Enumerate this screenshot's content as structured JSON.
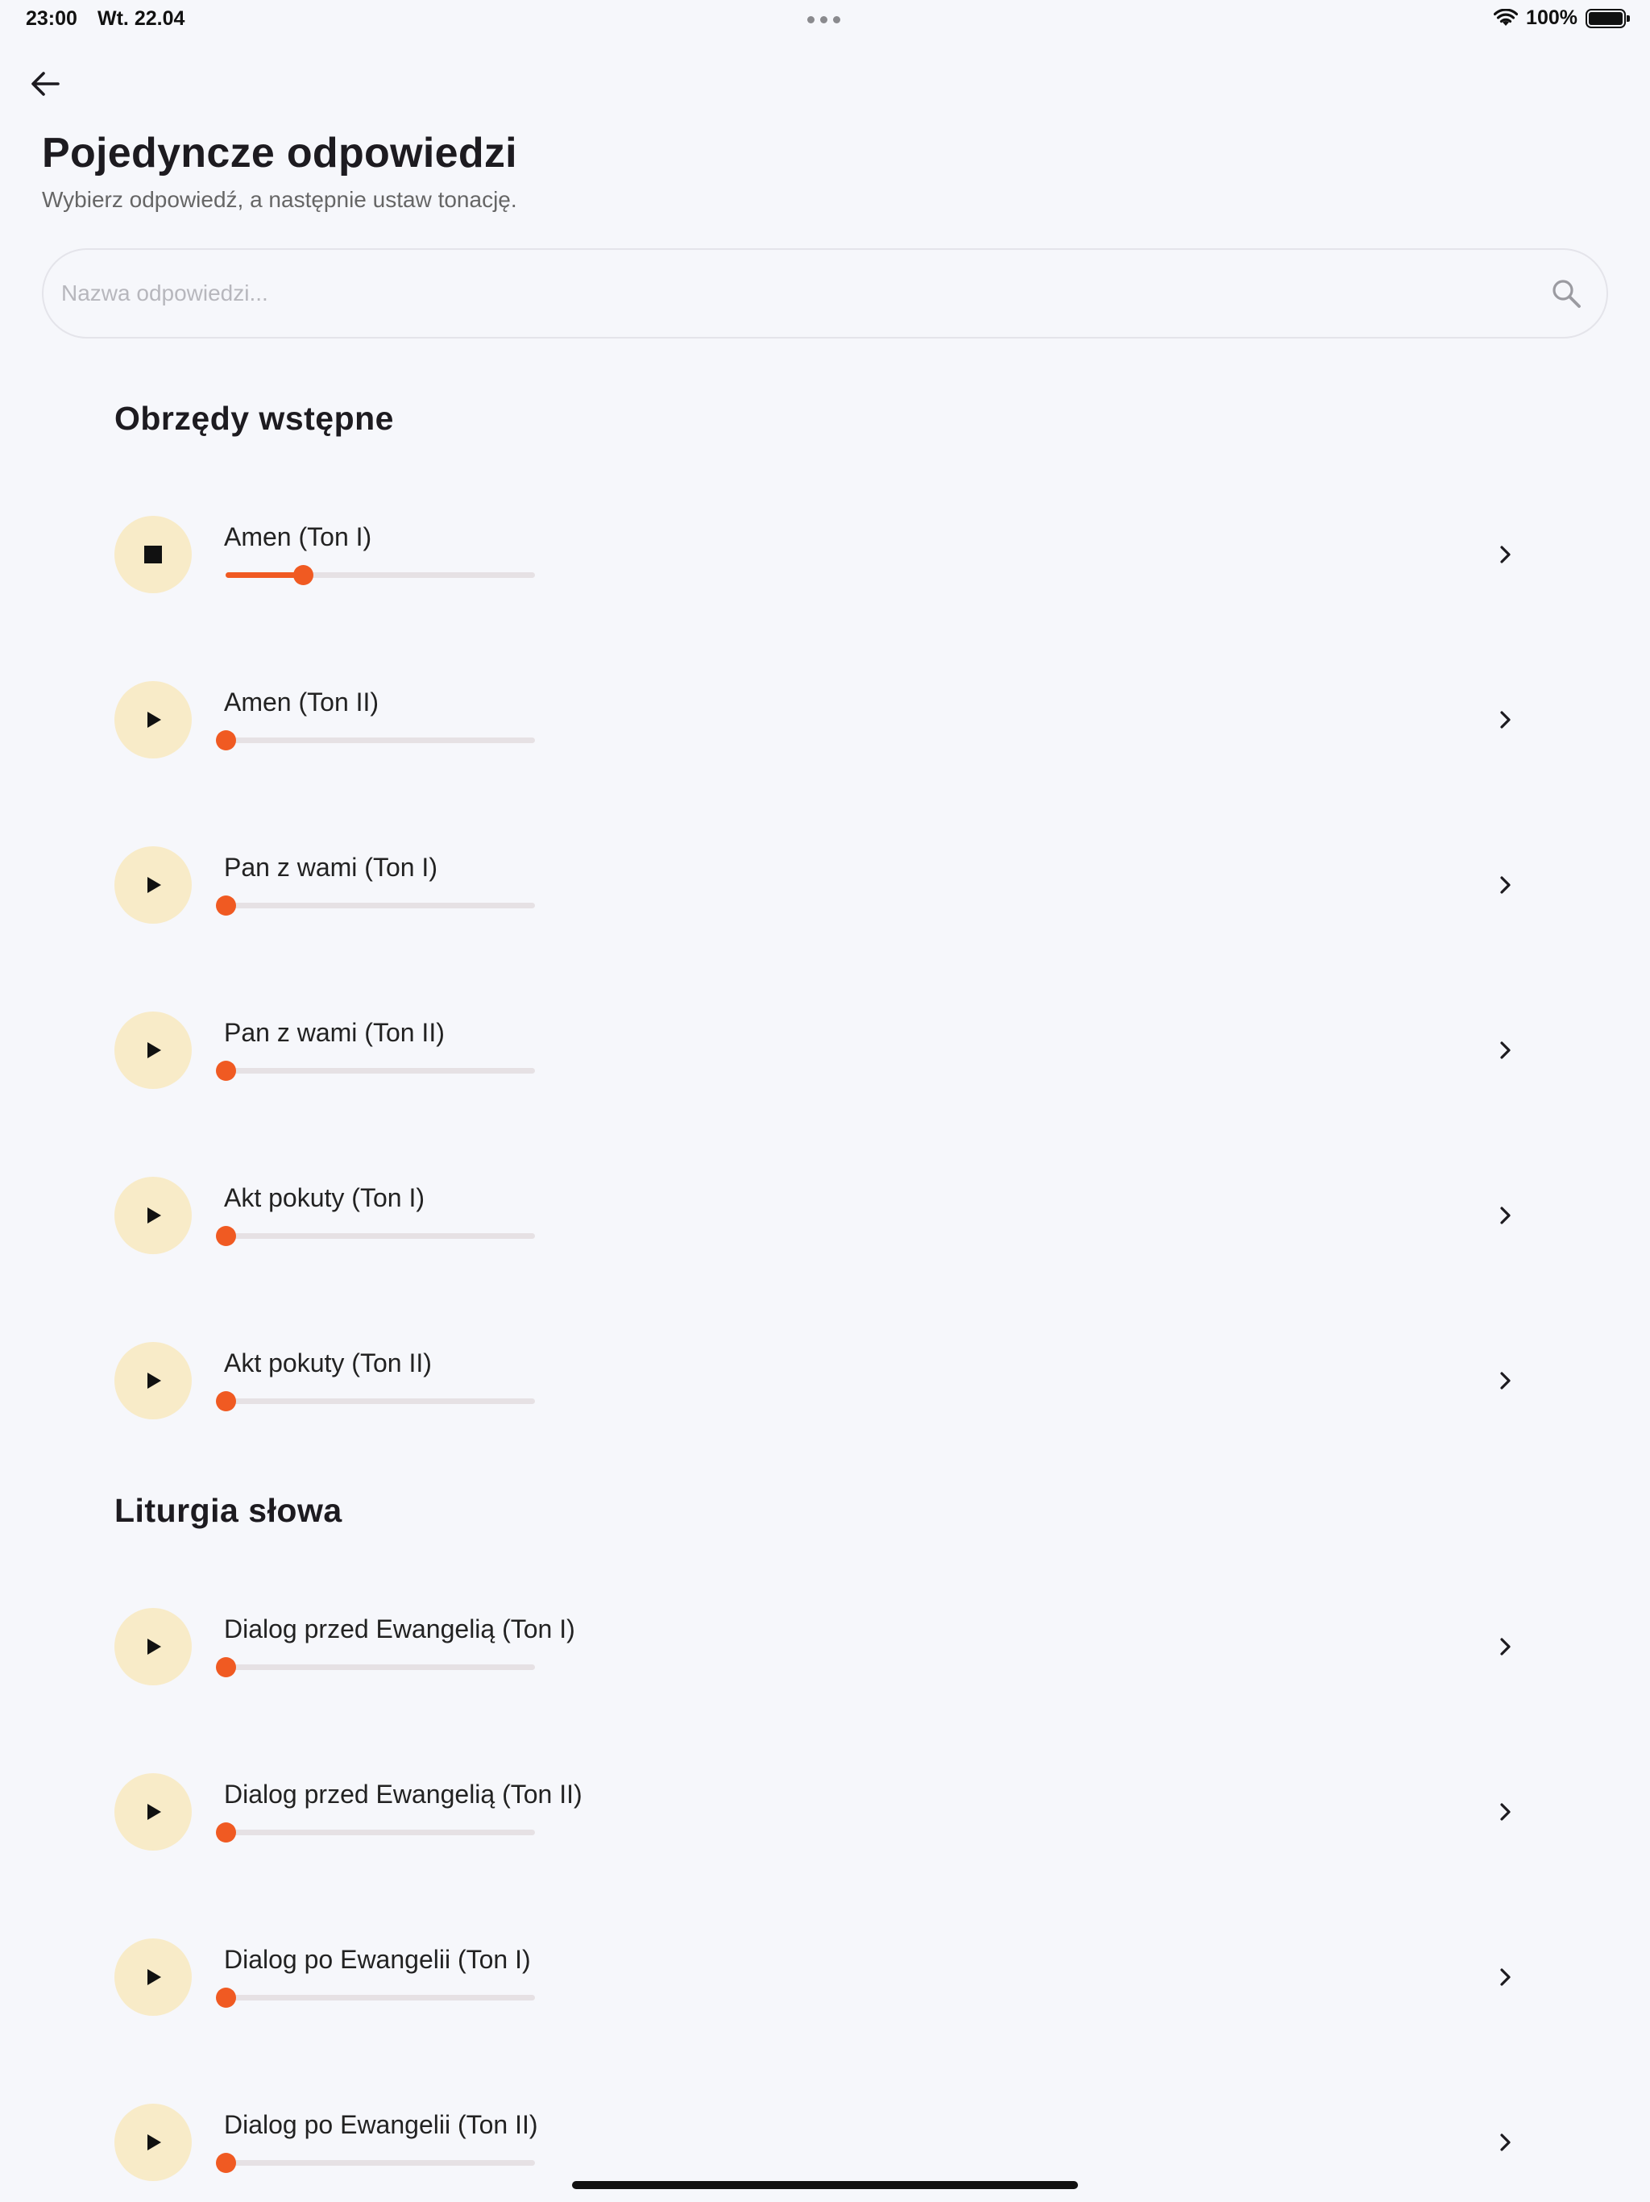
{
  "status_bar": {
    "time": "23:00",
    "date": "Wt. 22.04",
    "battery": "100%",
    "battery_level": 1.0
  },
  "header": {
    "back_icon": "arrow-left-icon",
    "title": "Pojedyncze odpowiedzi",
    "subtitle": "Wybierz odpowiedź, a następnie ustaw tonację."
  },
  "search": {
    "placeholder": "Nazwa odpowiedzi...",
    "value": "",
    "icon": "search-icon"
  },
  "colors": {
    "accent": "#f05a22",
    "play_button_bg": "#f8ebc8",
    "background": "#f6f7fb"
  },
  "sections": [
    {
      "title": "Obrzędy wstępne",
      "items": [
        {
          "label": "Amen (Ton I)",
          "state": "playing",
          "icon": "stop-icon",
          "progress": 0.25
        },
        {
          "label": "Amen (Ton II)",
          "state": "stopped",
          "icon": "play-icon",
          "progress": 0
        },
        {
          "label": "Pan z wami (Ton I)",
          "state": "stopped",
          "icon": "play-icon",
          "progress": 0
        },
        {
          "label": "Pan z wami (Ton II)",
          "state": "stopped",
          "icon": "play-icon",
          "progress": 0
        },
        {
          "label": "Akt pokuty (Ton I)",
          "state": "stopped",
          "icon": "play-icon",
          "progress": 0
        },
        {
          "label": "Akt pokuty (Ton II)",
          "state": "stopped",
          "icon": "play-icon",
          "progress": 0
        }
      ]
    },
    {
      "title": "Liturgia słowa",
      "items": [
        {
          "label": "Dialog przed Ewangelią (Ton I)",
          "state": "stopped",
          "icon": "play-icon",
          "progress": 0
        },
        {
          "label": "Dialog przed Ewangelią (Ton II)",
          "state": "stopped",
          "icon": "play-icon",
          "progress": 0
        },
        {
          "label": "Dialog po Ewangelii (Ton I)",
          "state": "stopped",
          "icon": "play-icon",
          "progress": 0
        },
        {
          "label": "Dialog po Ewangelii (Ton II)",
          "state": "stopped",
          "icon": "play-icon",
          "progress": 0
        }
      ]
    }
  ]
}
